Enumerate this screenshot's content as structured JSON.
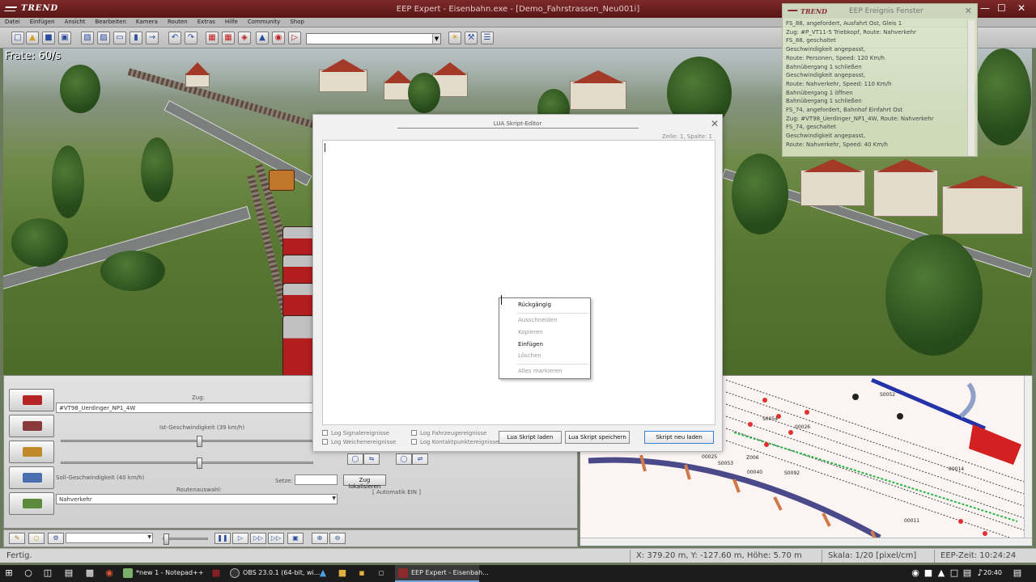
{
  "app": {
    "logo": "TREND",
    "title": "EEP Expert - Eisenbahn.exe - [Demo_Fahrstrassen_Neu001i]",
    "window_controls": [
      "—",
      "☐",
      "✕"
    ]
  },
  "menu": [
    "Datei",
    "Einfügen",
    "Ansicht",
    "Bearbeiten",
    "Kamera",
    "Routen",
    "Extras",
    "Hilfe",
    "Community",
    "Shop"
  ],
  "scene": {
    "frame_rate": "Frate: 60/s"
  },
  "event_window": {
    "logo": "TREND",
    "title": "EEP Ereignis Fenster",
    "close": "✕",
    "lines": [
      "FS_88, angefordert, Ausfahrt Ost, Gleis 1",
      "Zug: #P_VT11-5 Triebkopf, Route: Nahverkehr",
      "FS_88,  geschaltet",
      "Geschwindigkeit angepasst,",
      "Route: Personen, Speed: 120 Km/h",
      "Bahnübergang 1 schließen",
      "Geschwindigkeit angepasst,",
      "Route: Nahverkehr, Speed: 110 Km/h",
      "Bahnübergang 1 öffnen",
      "Bahnübergang 1 schließen",
      "FS_74, angefordert, Bahnhof Einfahrt Ost",
      "Zug: #VT98_Uerdinger_NP1_4W, Route: Nahverkehr",
      "FS_74,  geschaltet",
      "Geschwindigkeit angepasst,",
      "Route: Nahverkehr, Speed: 40 Km/h"
    ]
  },
  "control_panel": {
    "train_label": "Zug:",
    "train_value": "#VT98_Uerdinger_NP1_4W",
    "actual_speed_label": "Ist-Geschwindigkeit (39 km/h)",
    "actual_speed_fraction": 0.33,
    "target_speed_label": "Soll-Geschwindigkeit (40 km/h)",
    "target_speed_fraction": 0.33,
    "set_label": "Setze:",
    "set_value": "",
    "locate_button": "Zug lokalisieren",
    "route_label": "Routenauswahl:",
    "route_value": "Nahverkehr",
    "automatic": "[ Automatik EIN ]"
  },
  "lua_editor": {
    "title": "LUA Skript-Editor",
    "close": "✕",
    "position": "Zeile: 1, Spalte: 1",
    "content": "",
    "checkboxes": [
      "Log Signalereignisse",
      "Log Weichenereignisse",
      "Log Fahrzeugereignisse",
      "Log Kontaktpunktereignisse"
    ],
    "buttons": {
      "load": "Lua Skript laden",
      "save": "Lua Skript speichern",
      "reload": "Skript neu laden"
    }
  },
  "context_menu": {
    "items": [
      {
        "label": "Rückgängig",
        "enabled": true
      },
      {
        "label": "Ausschneiden",
        "enabled": false
      },
      {
        "label": "Kopieren",
        "enabled": false
      },
      {
        "label": "Einfügen",
        "enabled": true
      },
      {
        "label": "Löschen",
        "enabled": false
      },
      {
        "label": "Alles markieren",
        "enabled": false
      }
    ]
  },
  "map": {
    "labels": [
      "S0052",
      "S0053",
      "00025",
      "00026",
      "Z006",
      "S0054",
      "00040",
      "S0092",
      "00014",
      "00011"
    ]
  },
  "status": {
    "ready": "Fertig.",
    "coordinates": "X: 379.20 m, Y: -127.60 m, Höhe: 5.70 m",
    "scale": "Skala: 1/20 [pixel/cm]",
    "eep_time": "EEP-Zeit: 10:24:24"
  },
  "taskbar": {
    "tasks": [
      "*new 1 - Notepad++",
      "OBS 23.0.1 (64-bit, wi...",
      "EEP Expert - Eisenbah..."
    ],
    "time": "20:40"
  },
  "colors": {
    "title_bar": "#6e2020",
    "dialog_default_border": "#3c7fd6",
    "event_window_bg": "#dce8c8",
    "map_track_route": "#2433a8",
    "map_signal": "#e03030"
  }
}
